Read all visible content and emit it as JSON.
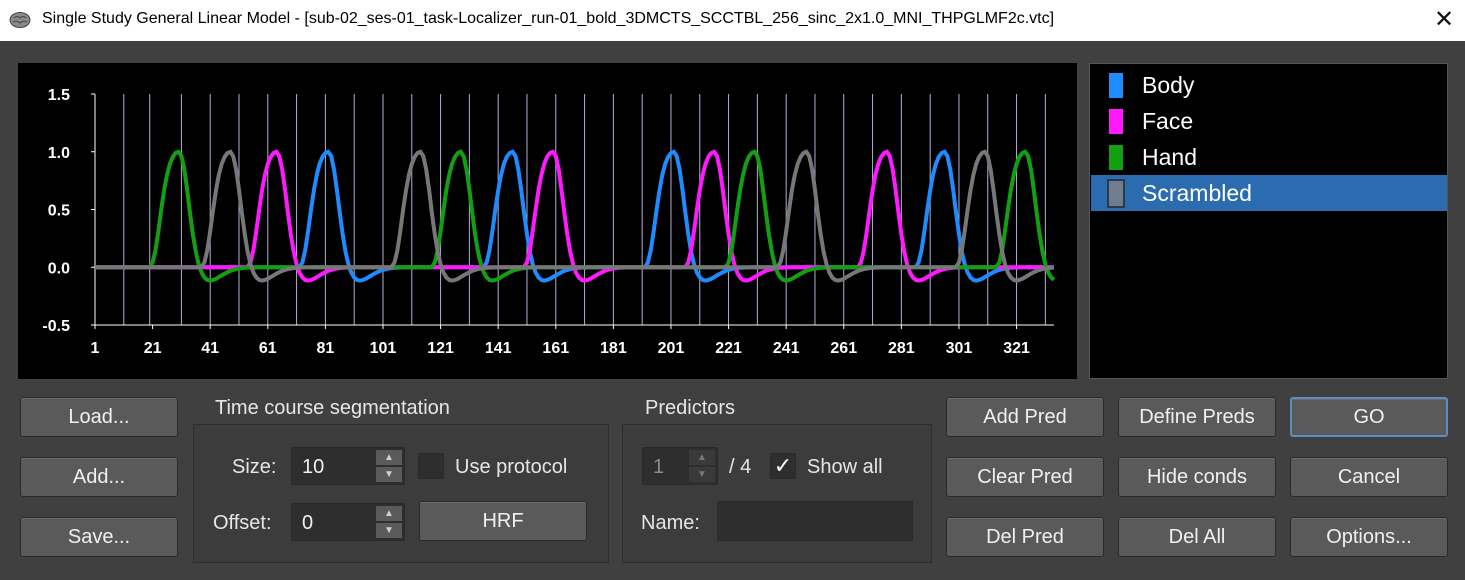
{
  "window": {
    "title": "Single Study General Linear Model - [sub-02_ses-01_task-Localizer_run-01_bold_3DMCTS_SCCTBL_256_sinc_2x1.0_MNI_THPGLMF2c.vtc]",
    "close_glyph": "✕"
  },
  "legend": {
    "items": [
      {
        "label": "Body",
        "color": "#1e8cff",
        "selected": false
      },
      {
        "label": "Face",
        "color": "#ff19ff",
        "selected": false
      },
      {
        "label": "Hand",
        "color": "#12a012",
        "selected": false
      },
      {
        "label": "Scrambled",
        "color": "#6f7d8c",
        "selected": true
      }
    ]
  },
  "chart_data": {
    "type": "line",
    "x_min": 1,
    "x_max": 334,
    "ylim": [
      -0.5,
      1.5
    ],
    "yticks": [
      "1.5",
      "1.0",
      "0.5",
      "0.0",
      "-0.5"
    ],
    "ytick_values": [
      1.5,
      1.0,
      0.5,
      0.0,
      -0.5
    ],
    "xticks": [
      "1",
      "21",
      "41",
      "61",
      "81",
      "101",
      "121",
      "141",
      "161",
      "181",
      "201",
      "221",
      "241",
      "261",
      "281",
      "301",
      "321"
    ],
    "xtick_values": [
      1,
      21,
      41,
      61,
      81,
      101,
      121,
      141,
      161,
      181,
      201,
      221,
      241,
      261,
      281,
      301,
      321
    ],
    "block_boundaries": [
      11,
      20,
      31,
      41,
      51,
      61,
      71,
      81,
      91,
      101,
      111,
      121,
      131,
      141,
      151,
      161,
      171,
      181,
      191,
      201,
      211,
      221,
      231,
      241,
      251,
      261,
      271,
      281,
      291,
      301,
      311,
      321,
      331
    ],
    "series": [
      {
        "name": "Body",
        "color": "#1e8cff",
        "block_starts": [
          71,
          135,
          191,
          285
        ]
      },
      {
        "name": "Face",
        "color": "#ff19ff",
        "block_starts": [
          53,
          149,
          205,
          265
        ]
      },
      {
        "name": "Hand",
        "color": "#12a012",
        "block_starts": [
          19,
          117,
          219,
          313
        ]
      },
      {
        "name": "Scrambled",
        "color": "#777777",
        "block_starts": [
          37,
          103,
          237,
          299
        ]
      }
    ]
  },
  "buttons": {
    "load": "Load...",
    "add": "Add...",
    "save": "Save...",
    "hrf": "HRF",
    "add_pred": "Add Pred",
    "define_preds": "Define Preds",
    "go": "GO",
    "clear_pred": "Clear Pred",
    "hide_conds": "Hide conds",
    "cancel": "Cancel",
    "del_pred": "Del Pred",
    "del_all": "Del All",
    "options": "Options..."
  },
  "segmentation": {
    "group_title": "Time course segmentation",
    "size_label": "Size:",
    "size_value": "10",
    "offset_label": "Offset:",
    "offset_value": "0",
    "use_protocol_label": "Use protocol",
    "use_protocol_checked": false
  },
  "predictors": {
    "group_title": "Predictors",
    "current": "1",
    "total_label": "/ 4",
    "show_all_label": "Show all",
    "show_all_checked": true,
    "check_glyph": "✓",
    "name_label": "Name:",
    "name_value": ""
  }
}
